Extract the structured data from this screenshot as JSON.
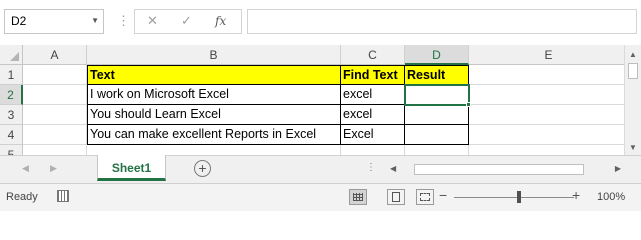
{
  "formula_bar": {
    "name_box": "D2",
    "cancel_glyph": "✕",
    "enter_glyph": "✓",
    "fx_label": "fx",
    "formula": ""
  },
  "columns": [
    "A",
    "B",
    "C",
    "D",
    "E"
  ],
  "rows": [
    "1",
    "2",
    "3",
    "4",
    "5"
  ],
  "active_cell": "D2",
  "cells": {
    "B1": "Text",
    "C1": "Find Text",
    "D1": "Result",
    "B2": "I work on Microsoft Excel",
    "C2": "excel",
    "D2": "",
    "B3": "You should Learn Excel",
    "C3": "excel",
    "D3": "",
    "B4": "You can make excellent Reports in Excel",
    "C4": "Excel",
    "D4": ""
  },
  "header_fill_color": "#ffff00",
  "accent_color": "#217346",
  "sheet_tabs": [
    {
      "label": "Sheet1",
      "active": true
    }
  ],
  "status": {
    "mode": "Ready",
    "zoom": "100%",
    "views": [
      "normal-view",
      "page-layout-view",
      "page-break-preview"
    ],
    "active_view": "normal-view"
  }
}
